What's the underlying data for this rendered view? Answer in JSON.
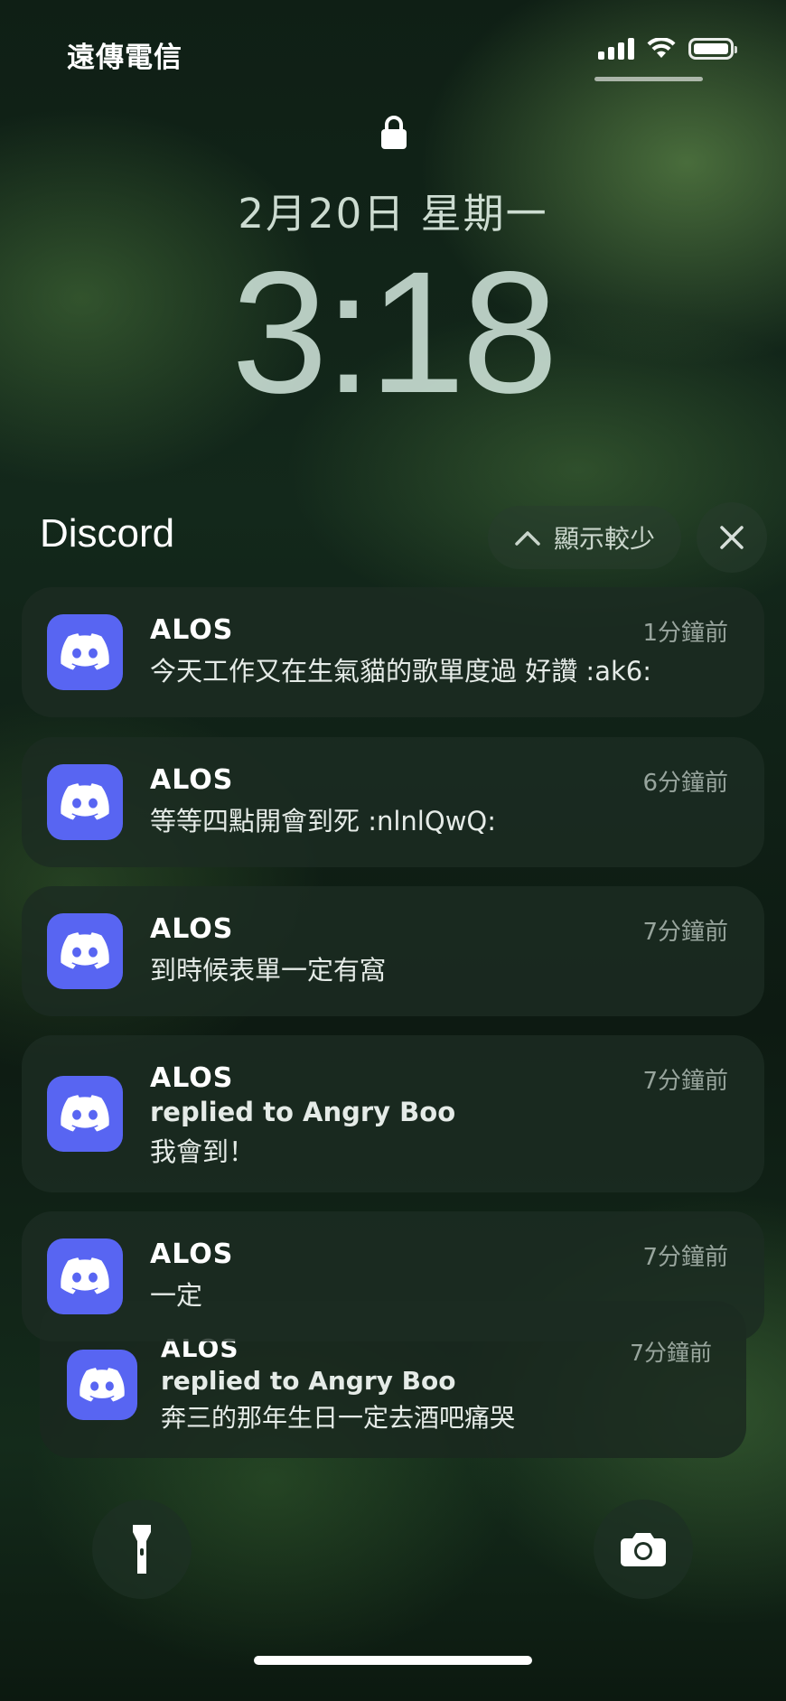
{
  "status_bar": {
    "carrier": "遠傳電信"
  },
  "lock_screen": {
    "date": "2月20日 星期一",
    "time": "3:18"
  },
  "group": {
    "app_name": "Discord",
    "show_less_label": "顯示較少",
    "close_icon": "close-icon",
    "collapse_icon": "chevron-up-icon"
  },
  "notifications": [
    {
      "sender": "ALOS",
      "time_ago": "1分鐘前",
      "line1": "今天工作又在生氣貓的歌單度過 好讚 :ak6:"
    },
    {
      "sender": "ALOS",
      "time_ago": "6分鐘前",
      "line1": "等等四點開會到死 :nlnlQwQ:"
    },
    {
      "sender": "ALOS",
      "time_ago": "7分鐘前",
      "line1": "到時候表單一定有窩"
    },
    {
      "sender": "ALOS",
      "time_ago": "7分鐘前",
      "line1": "replied to Angry Boo",
      "line2": "我會到！"
    },
    {
      "sender": "ALOS",
      "time_ago": "7分鐘前",
      "line1": "一定"
    },
    {
      "sender": "ALOS",
      "time_ago": "7分鐘前",
      "line1": "replied to Angry Boo",
      "line2": "奔三的那年生日一定去酒吧痛哭"
    }
  ],
  "bottom": {
    "left_button_icon": "flashlight-icon",
    "right_button_icon": "camera-icon"
  },
  "colors": {
    "discord_brand": "#5865f2",
    "wallpaper_dark_green": "#13281b"
  }
}
